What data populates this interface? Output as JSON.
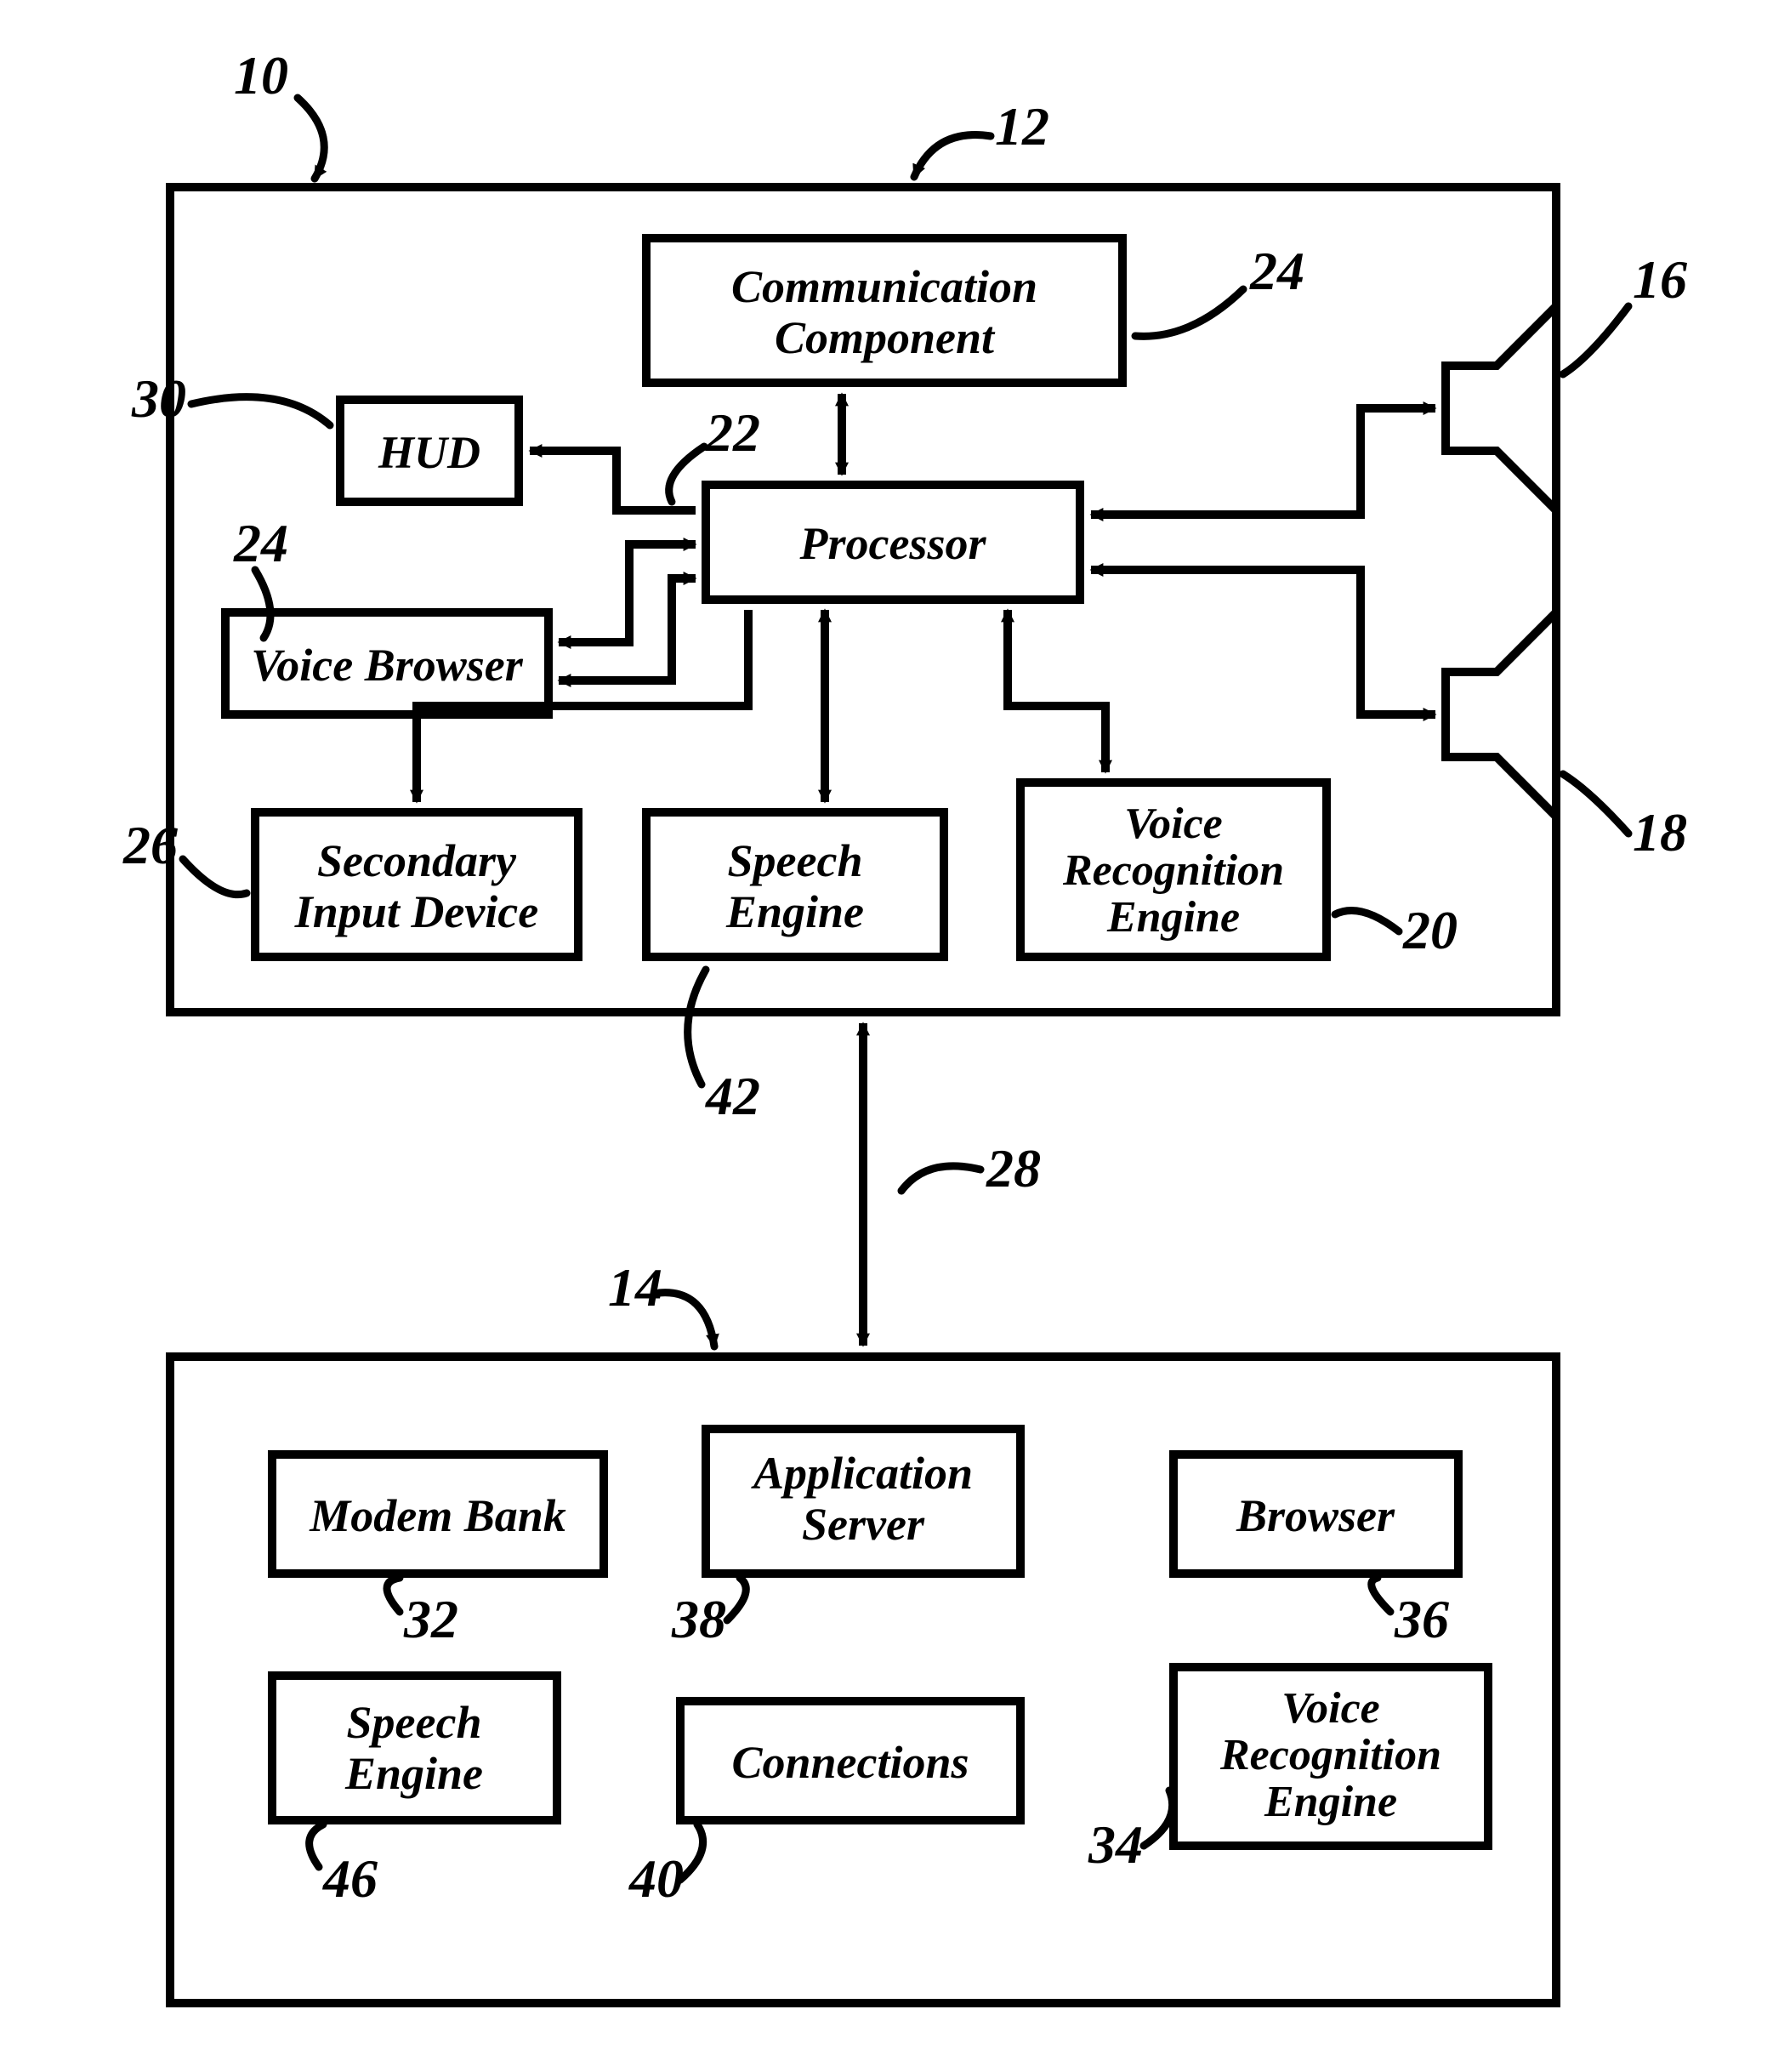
{
  "refs": {
    "r10": "10",
    "r12": "12",
    "r14": "14",
    "r16": "16",
    "r18": "18",
    "r20": "20",
    "r22": "22",
    "r24a": "24",
    "r24b": "24",
    "r26": "26",
    "r28": "28",
    "r30": "30",
    "r32": "32",
    "r34": "34",
    "r36": "36",
    "r38": "38",
    "r40": "40",
    "r42": "42",
    "r46": "46"
  },
  "boxes": {
    "commComp1": "Communication",
    "commComp2": "Component",
    "processor": "Processor",
    "hud": "HUD",
    "voiceBrowser": "Voice Browser",
    "secInput1": "Secondary",
    "secInput2": "Input Device",
    "speechEngTop1": "Speech",
    "speechEngTop2": "Engine",
    "vreTop1": "Voice",
    "vreTop2": "Recognition",
    "vreTop3": "Engine",
    "modemBank": "Modem Bank",
    "appServer1": "Application",
    "appServer2": "Server",
    "browser": "Browser",
    "speechEngBot1": "Speech",
    "speechEngBot2": "Engine",
    "connections": "Connections",
    "vreBot1": "Voice",
    "vreBot2": "Recognition",
    "vreBot3": "Engine"
  }
}
